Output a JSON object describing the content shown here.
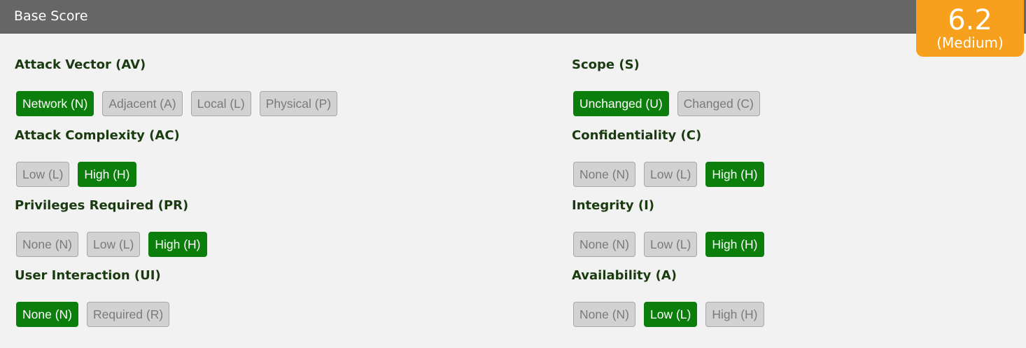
{
  "header": {
    "title": "Base Score"
  },
  "score": {
    "value": "6.2",
    "severity": "(Medium)",
    "color": "#f7a01d"
  },
  "colors": {
    "selected": "#0b7e0b",
    "unselected": "#d2d2d2",
    "header": "#666666"
  },
  "metrics": {
    "av": {
      "title": "Attack Vector (AV)",
      "options": [
        "Network (N)",
        "Adjacent (A)",
        "Local (L)",
        "Physical (P)"
      ],
      "selected": 0
    },
    "ac": {
      "title": "Attack Complexity (AC)",
      "options": [
        "Low (L)",
        "High (H)"
      ],
      "selected": 1
    },
    "pr": {
      "title": "Privileges Required (PR)",
      "options": [
        "None (N)",
        "Low (L)",
        "High (H)"
      ],
      "selected": 2
    },
    "ui": {
      "title": "User Interaction (UI)",
      "options": [
        "None (N)",
        "Required (R)"
      ],
      "selected": 0
    },
    "s": {
      "title": "Scope (S)",
      "options": [
        "Unchanged (U)",
        "Changed (C)"
      ],
      "selected": 0
    },
    "c": {
      "title": "Confidentiality (C)",
      "options": [
        "None (N)",
        "Low (L)",
        "High (H)"
      ],
      "selected": 2
    },
    "i": {
      "title": "Integrity (I)",
      "options": [
        "None (N)",
        "Low (L)",
        "High (H)"
      ],
      "selected": 2
    },
    "a": {
      "title": "Availability (A)",
      "options": [
        "None (N)",
        "Low (L)",
        "High (H)"
      ],
      "selected": 1
    }
  }
}
